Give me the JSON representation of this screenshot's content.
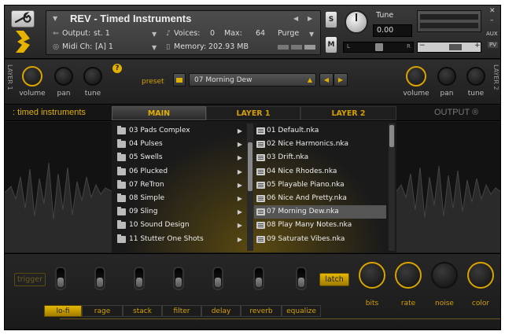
{
  "header": {
    "title": "REV - Timed Instruments",
    "output_label": "Output:",
    "output_value": "st. 1",
    "midi_label": "Midi Ch:",
    "midi_value": "[A]  1",
    "voices_label": "Voices:",
    "voices_value": "0",
    "max_label": "Max:",
    "max_value": "64",
    "purge_label": "Purge",
    "memory_label": "Memory:",
    "memory_value": "202.93 MB",
    "solo_label": "S",
    "mute_label": "M",
    "tune_label": "Tune",
    "tune_value": "0.00",
    "pan_left": "L",
    "pan_right": "R",
    "aux_label": "AUX",
    "pv_label": "PV",
    "minus_label": "−",
    "plus_label": "+"
  },
  "layer_strip": {
    "layer1_label": "LAYER 1",
    "layer2_label": "LAYER 2",
    "volume_label": "volume",
    "pan_label": "pan",
    "tune_label": "tune",
    "help_label": "?",
    "preset_label": "preset",
    "preset_value": "07 Morning Dew"
  },
  "tabs": {
    "brand": ": timed instruments",
    "main": "MAIN",
    "layer1": "LAYER 1",
    "layer2": "LAYER 2",
    "output": "OUTPUT ®"
  },
  "browser": {
    "folders": [
      "03 Pads Complex",
      "04 Pulses",
      "05 Swells",
      "06 Plucked",
      "07 ReTron",
      "08 Simple",
      "09 Sling",
      "10 Sound Design",
      "11 Stutter One Shots"
    ],
    "files": [
      "01 Default.nka",
      "02 Nice Harmonics.nka",
      "03 Drift.nka",
      "04 Nice Rhodes.nka",
      "05 Playable Piano.nka",
      "06 Nice And Pretty.nka",
      "07 Morning Dew.nka",
      "08 Play Many Notes.nka",
      "09 Saturate Vibes.nka"
    ],
    "selected_file_index": 6
  },
  "bottom": {
    "trigger_label": "trigger",
    "latch_label": "latch",
    "fx_tabs": [
      "lo-fi",
      "rage",
      "stack",
      "filter",
      "delay",
      "reverb",
      "equalize"
    ],
    "selected_fx_index": 0,
    "knobs": [
      "bits",
      "rate",
      "noise",
      "color"
    ]
  },
  "colors": {
    "accent": "#d9a300",
    "background": "#1b1b1b"
  }
}
